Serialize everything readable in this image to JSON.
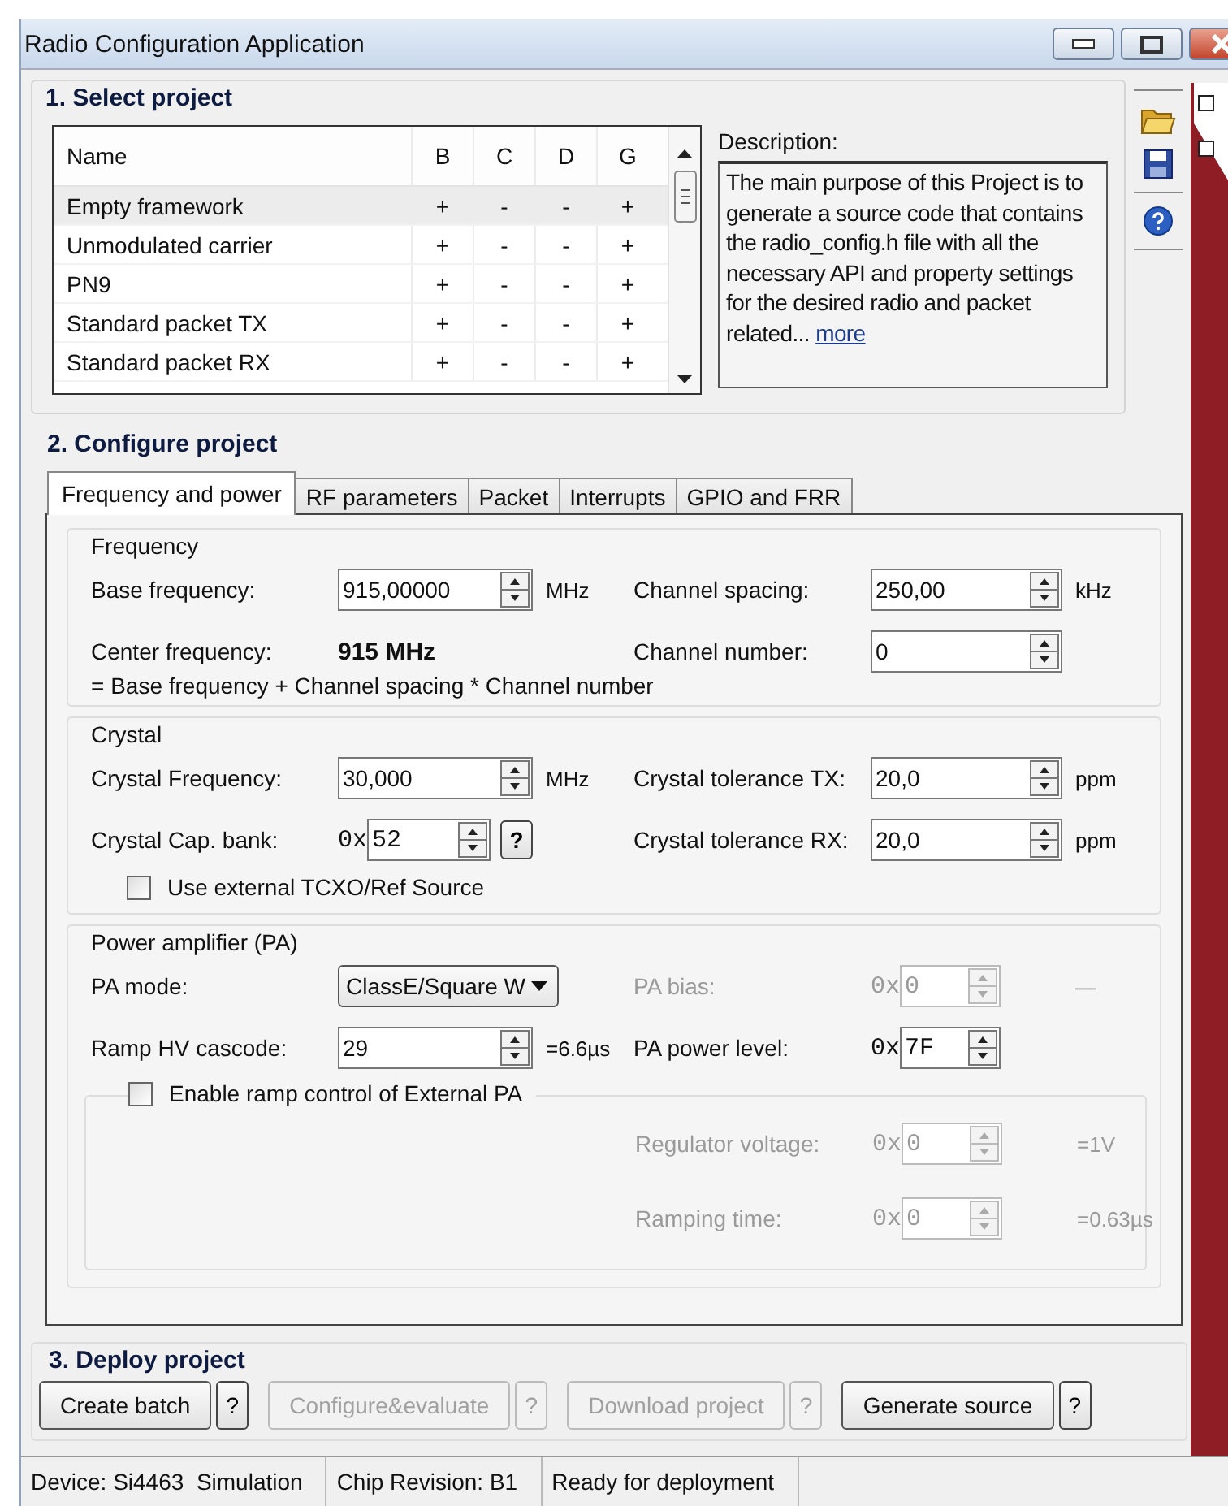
{
  "window": {
    "title": "Radio Configuration Application"
  },
  "select_project": {
    "title": "1. Select project",
    "columns": [
      "Name",
      "B",
      "C",
      "D",
      "G"
    ],
    "rows": [
      {
        "cells": [
          "Empty framework",
          "+",
          "-",
          "-",
          "+"
        ],
        "selected": true
      },
      {
        "cells": [
          "Unmodulated carrier",
          "+",
          "-",
          "-",
          "+"
        ],
        "selected": false
      },
      {
        "cells": [
          "PN9",
          "+",
          "-",
          "-",
          "+"
        ],
        "selected": false
      },
      {
        "cells": [
          "Standard packet TX",
          "+",
          "-",
          "-",
          "+"
        ],
        "selected": false
      },
      {
        "cells": [
          "Standard packet RX",
          "+",
          "-",
          "-",
          "+"
        ],
        "selected": false
      }
    ],
    "description_label": "Description:",
    "description": "The main purpose of this Project is to generate a source code that contains the radio_config.h file with all the necessary API and property settings for the desired radio and packet related...",
    "more_link": "more"
  },
  "configure_project": {
    "title": "2. Configure project",
    "tabs": [
      {
        "label": "Frequency and power",
        "selected": true
      },
      {
        "label": "RF parameters",
        "selected": false
      },
      {
        "label": "Packet",
        "selected": false
      },
      {
        "label": "Interrupts",
        "selected": false
      },
      {
        "label": "GPIO and FRR",
        "selected": false
      }
    ],
    "groups": [
      {
        "title": "Frequency",
        "rows": [
          {
            "left": {
              "label": "Base frequency:",
              "kind": "spin",
              "value": "915,00000",
              "unit": "MHz",
              "disabled": false
            },
            "right": {
              "label": "Channel spacing:",
              "kind": "spin",
              "value": "250,00",
              "unit": "kHz",
              "disabled": false
            }
          },
          {
            "left": {
              "label": "Center frequency:",
              "kind": "static",
              "value": "915 MHz"
            },
            "right": {
              "label": "Channel number:",
              "kind": "spin",
              "value": "0",
              "disabled": false
            }
          }
        ],
        "note": "= Base frequency + Channel spacing * Channel number"
      },
      {
        "title": "Crystal",
        "rows": [
          {
            "left": {
              "label": "Crystal Frequency:",
              "kind": "spin",
              "value": "30,000",
              "unit": "MHz",
              "disabled": false
            },
            "right": {
              "label": "Crystal tolerance TX:",
              "kind": "spin",
              "value": "20,0",
              "unit": "ppm",
              "disabled": false
            }
          },
          {
            "left": {
              "label": "Crystal Cap. bank:",
              "kind": "spin",
              "prefix": "0x",
              "value": "52",
              "help": "?",
              "disabled": false
            },
            "right": {
              "label": "Crystal tolerance RX:",
              "kind": "spin",
              "value": "20,0",
              "unit": "ppm",
              "disabled": false
            }
          }
        ],
        "checkbox": {
          "label": "Use external TCXO/Ref Source",
          "checked": false
        }
      },
      {
        "title": "Power amplifier (PA)",
        "rows": [
          {
            "left": {
              "label": "PA mode:",
              "kind": "combo",
              "value": "ClassE/Square W"
            },
            "right": {
              "label": "PA bias:",
              "kind": "spin",
              "prefix": "0x",
              "value": "0",
              "unit": "—",
              "disabled": true
            }
          },
          {
            "left": {
              "label": "Ramp HV cascode:",
              "kind": "spin",
              "value": "29",
              "unit": "=6.6µs",
              "disabled": false
            },
            "right": {
              "label": "PA power level:",
              "kind": "spin",
              "prefix": "0x",
              "value": "7F",
              "disabled": false
            }
          }
        ],
        "subgroup": {
          "label": "Enable ramp control of External PA",
          "checked": false,
          "rows": [
            {
              "right": {
                "label": "Regulator voltage:",
                "kind": "spin",
                "prefix": "0x",
                "value": "0",
                "unit": "=1V",
                "disabled": true
              }
            },
            {
              "right": {
                "label": "Ramping time:",
                "kind": "spin",
                "prefix": "0x",
                "value": "0",
                "unit": "=0.63µs",
                "disabled": true
              }
            }
          ]
        }
      }
    ]
  },
  "deploy_project": {
    "title": "3. Deploy project",
    "buttons": [
      {
        "label": "Create batch",
        "help": "?",
        "disabled": false
      },
      {
        "label": "Configure&evaluate",
        "help": "?",
        "disabled": true
      },
      {
        "label": "Download project",
        "help": "?",
        "disabled": true
      },
      {
        "label": "Generate source",
        "help": "?",
        "disabled": false
      }
    ]
  },
  "status_bar": [
    "Device: Si4463  Simulation",
    "Chip Revision: B1",
    "Ready for deployment"
  ]
}
